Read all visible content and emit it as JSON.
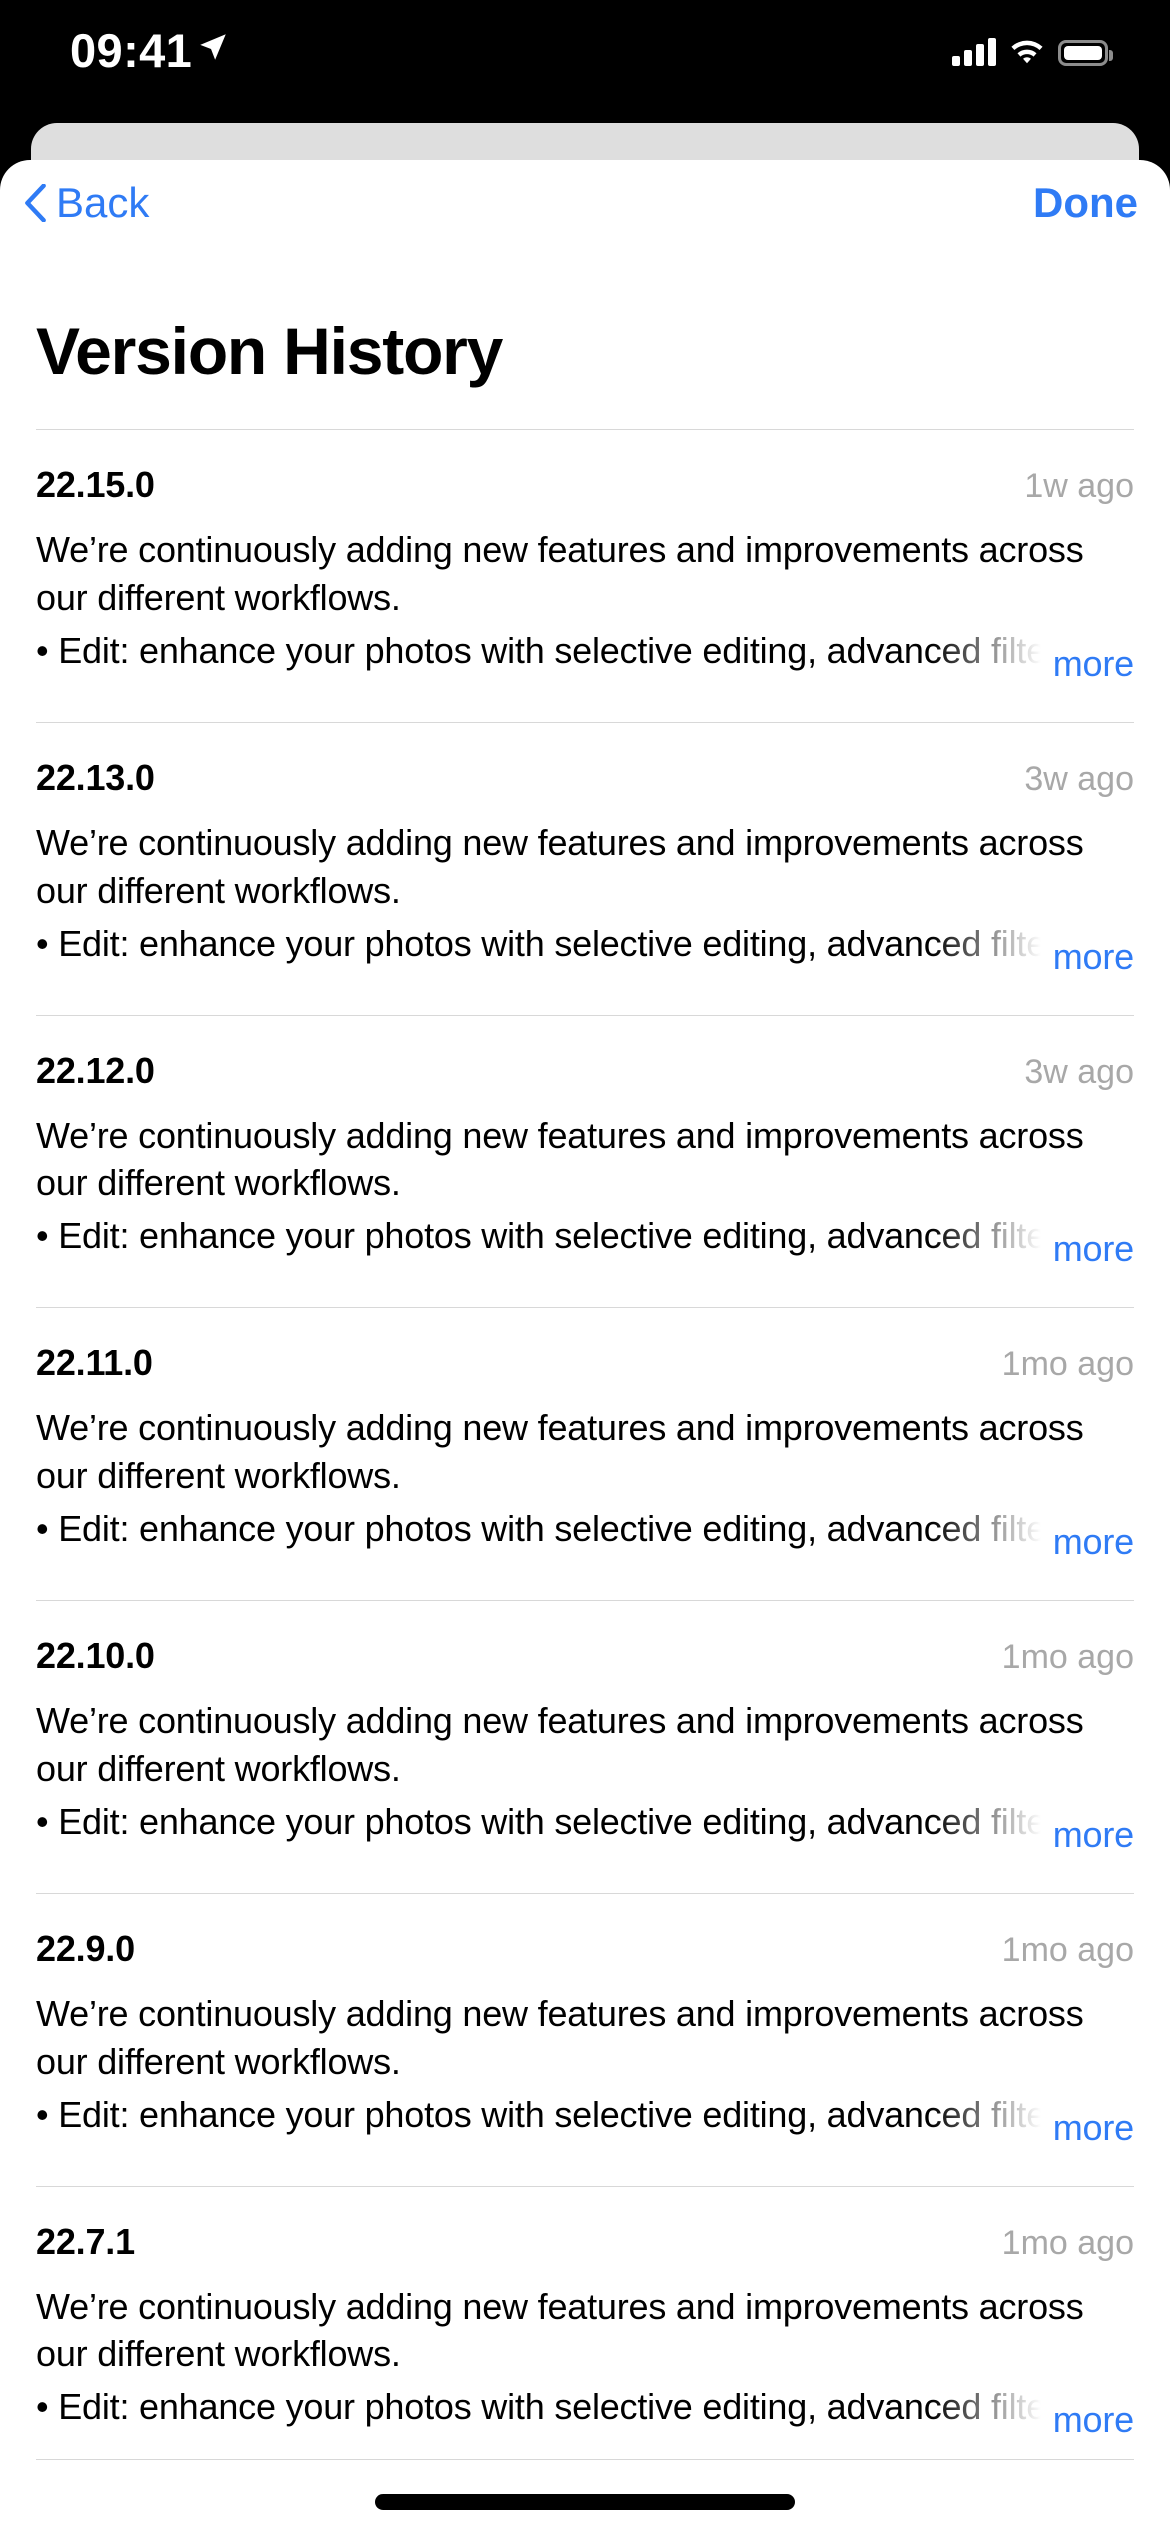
{
  "status_bar": {
    "time": "09:41",
    "location_icon": "location-arrow-icon",
    "cellular_icon": "cellular-bars-icon",
    "wifi_icon": "wifi-icon",
    "battery_icon": "battery-full-icon"
  },
  "nav": {
    "back_label": "Back",
    "back_icon": "chevron-left-icon",
    "done_label": "Done"
  },
  "page": {
    "title": "Version History"
  },
  "shared": {
    "body_text": "We’re continuously adding new features and improvements across our different workflows.",
    "bullet_text": "• Edit: enhance your photos with selective editing, advanced filters and more",
    "more_label": "more"
  },
  "colors": {
    "accent_blue": "#2f7bf5",
    "timestamp_gray": "#a8a8a8",
    "separator": "#d8d8d8",
    "peek_card": "#dedede",
    "sheet_background": "#ffffff",
    "backdrop": "#000000"
  },
  "versions": [
    {
      "version": "22.15.0",
      "time_ago": "1w ago"
    },
    {
      "version": "22.13.0",
      "time_ago": "3w ago"
    },
    {
      "version": "22.12.0",
      "time_ago": "3w ago"
    },
    {
      "version": "22.11.0",
      "time_ago": "1mo ago"
    },
    {
      "version": "22.10.0",
      "time_ago": "1mo ago"
    },
    {
      "version": "22.9.0",
      "time_ago": "1mo ago"
    },
    {
      "version": "22.7.1",
      "time_ago": "1mo ago"
    }
  ]
}
